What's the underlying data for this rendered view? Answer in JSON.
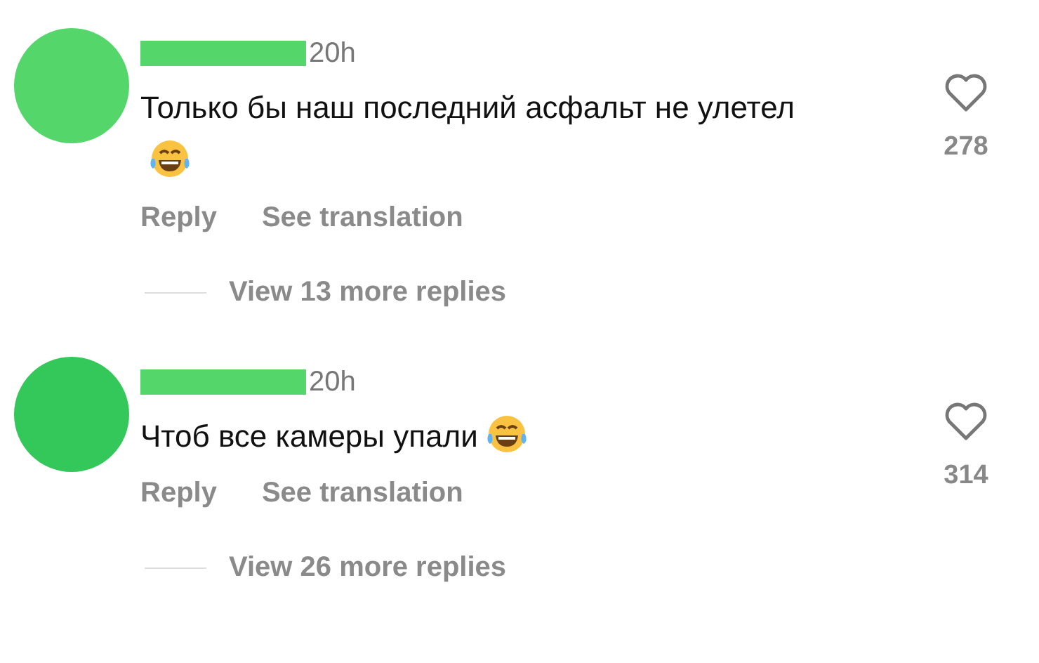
{
  "comments": [
    {
      "color": "#55d66b",
      "time": "20h",
      "text": "Только бы наш последний асфальт не улетел",
      "emoji": true,
      "actions": [
        "Reply",
        "See translation"
      ],
      "likes": "278",
      "liked": false,
      "more_replies": "View 13 more replies"
    },
    {
      "color": "#34c759",
      "time": "20h",
      "text": "Чтоб все камеры упали",
      "emoji": true,
      "actions": [
        "Reply",
        "See translation"
      ],
      "likes": "314",
      "liked": false,
      "more_replies": "View 26 more replies"
    }
  ]
}
